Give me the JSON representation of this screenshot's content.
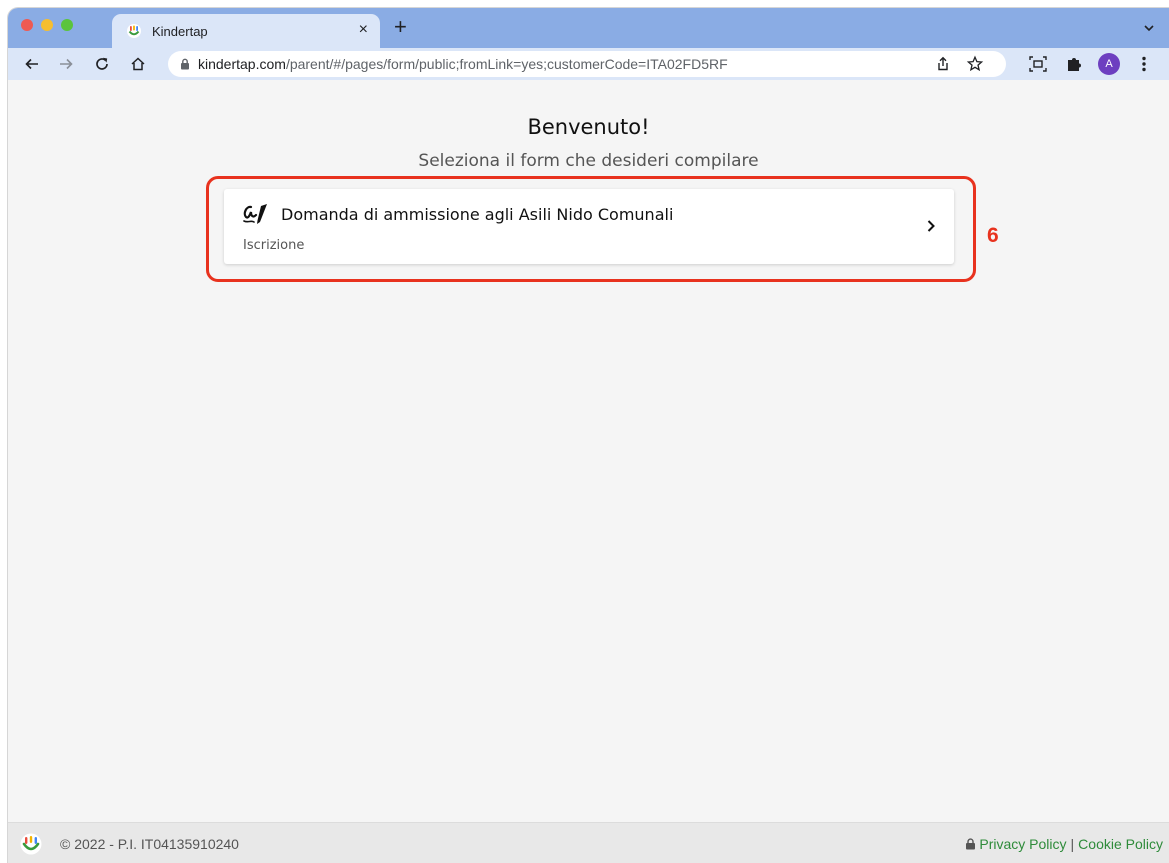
{
  "browser": {
    "tab_title": "Kindertap",
    "url_host": "kindertap.com",
    "url_path": "/parent/#/pages/form/public;fromLink=yes;customerCode=ITA02FD5RF",
    "profile_initial": "A",
    "new_tab_label": "+",
    "close_tab_label": "×"
  },
  "page": {
    "title": "Benvenuto!",
    "subtitle": "Seleziona il form che desideri compilare"
  },
  "form_card": {
    "title": "Domanda di ammissione agli Asili Nido Comunali",
    "category": "Iscrizione",
    "icon": "signature-icon"
  },
  "annotation": {
    "step_number": "6",
    "color": "#e8321e"
  },
  "footer": {
    "copyright": "© 2022 - P.I. IT04135910240",
    "privacy_label": "Privacy Policy",
    "separator": "|",
    "cookie_label": "Cookie Policy",
    "link_color": "#2e8b3a"
  },
  "colors": {
    "tabstrip": "#8aace4",
    "toolbar": "#dbe6f8",
    "content_bg": "#f5f5f5"
  }
}
